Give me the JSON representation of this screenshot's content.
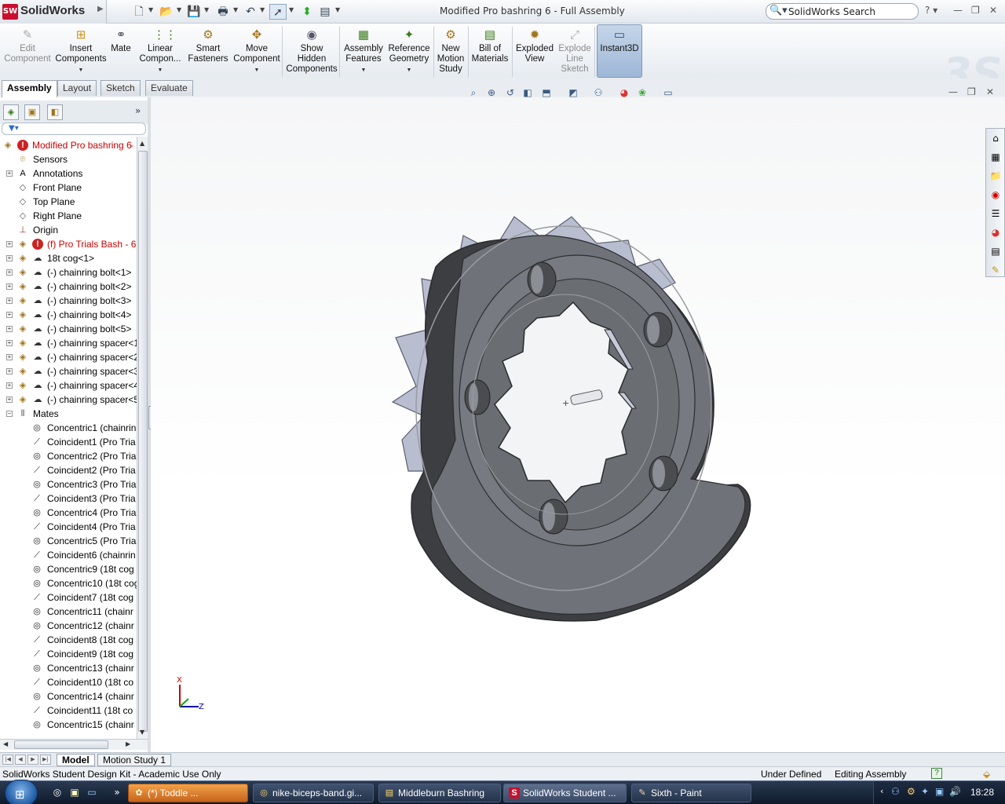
{
  "app": {
    "brand": "SolidWorks",
    "logo_letters": "SW",
    "title": "Modified Pro bashring 6 -  Full Assembly"
  },
  "search": {
    "placeholder": "SolidWorks Search"
  },
  "ribbon": {
    "buttons": [
      {
        "label": "Edit\nComponent",
        "icon": "edit-component-icon",
        "enabled": false
      },
      {
        "label": "Insert\nComponents",
        "icon": "insert-components-icon",
        "enabled": true
      },
      {
        "label": "Mate",
        "icon": "mate-icon",
        "enabled": true
      },
      {
        "label": "Linear\nCompon...",
        "icon": "linear-pattern-icon",
        "enabled": true
      },
      {
        "label": "Smart\nFasteners",
        "icon": "smart-fasteners-icon",
        "enabled": true
      },
      {
        "label": "Move\nComponent",
        "icon": "move-component-icon",
        "enabled": true
      },
      {
        "label": "Show\nHidden\nComponents",
        "icon": "show-hidden-icon",
        "enabled": true
      },
      {
        "label": "Assembly\nFeatures",
        "icon": "assembly-features-icon",
        "enabled": true
      },
      {
        "label": "Reference\nGeometry",
        "icon": "reference-geometry-icon",
        "enabled": true
      },
      {
        "label": "New\nMotion\nStudy",
        "icon": "motion-study-icon",
        "enabled": true
      },
      {
        "label": "Bill of\nMaterials",
        "icon": "bom-icon",
        "enabled": true
      },
      {
        "label": "Exploded\nView",
        "icon": "exploded-view-icon",
        "enabled": true
      },
      {
        "label": "Explode\nLine\nSketch",
        "icon": "explode-line-icon",
        "enabled": false
      },
      {
        "label": "Instant3D",
        "icon": "instant3d-icon",
        "enabled": true
      }
    ]
  },
  "command_tabs": [
    "Assembly",
    "Layout",
    "Sketch",
    "Evaluate"
  ],
  "tree": {
    "root": "Modified Pro bashring 6",
    "items": [
      {
        "label": "Sensors",
        "icon": "sensor-icon",
        "expand": false,
        "level": 1
      },
      {
        "label": "Annotations",
        "icon": "annotations-icon",
        "expand": true,
        "level": 1
      },
      {
        "label": "Front Plane",
        "icon": "plane-icon",
        "expand": false,
        "level": 1
      },
      {
        "label": "Top Plane",
        "icon": "plane-icon",
        "expand": false,
        "level": 1
      },
      {
        "label": "Right Plane",
        "icon": "plane-icon",
        "expand": false,
        "level": 1
      },
      {
        "label": "Origin",
        "icon": "origin-icon",
        "expand": false,
        "level": 1
      },
      {
        "label": "(f) Pro Trials Bash - 6<",
        "icon": "part-icon",
        "expand": true,
        "level": 1,
        "error": true
      },
      {
        "label": "18t cog<1>",
        "icon": "part-icon",
        "expand": true,
        "level": 1
      },
      {
        "label": "(-) chainring bolt<1>",
        "icon": "part-icon",
        "expand": true,
        "level": 1
      },
      {
        "label": "(-) chainring bolt<2>",
        "icon": "part-icon",
        "expand": true,
        "level": 1
      },
      {
        "label": "(-) chainring bolt<3>",
        "icon": "part-icon",
        "expand": true,
        "level": 1
      },
      {
        "label": "(-) chainring bolt<4>",
        "icon": "part-icon",
        "expand": true,
        "level": 1
      },
      {
        "label": "(-) chainring bolt<5>",
        "icon": "part-icon",
        "expand": true,
        "level": 1
      },
      {
        "label": "(-) chainring spacer<1",
        "icon": "part-icon",
        "expand": true,
        "level": 1
      },
      {
        "label": "(-) chainring spacer<2",
        "icon": "part-icon",
        "expand": true,
        "level": 1
      },
      {
        "label": "(-) chainring spacer<3",
        "icon": "part-icon",
        "expand": true,
        "level": 1
      },
      {
        "label": "(-) chainring spacer<4",
        "icon": "part-icon",
        "expand": true,
        "level": 1
      },
      {
        "label": "(-) chainring spacer<5",
        "icon": "part-icon",
        "expand": true,
        "level": 1
      },
      {
        "label": "Mates",
        "icon": "mates-icon",
        "expand": true,
        "level": 0,
        "open": true
      },
      {
        "label": "Concentric1 (chainrin",
        "icon": "concentric-icon",
        "level": 2
      },
      {
        "label": "Coincident1 (Pro Tria",
        "icon": "coincident-icon",
        "level": 2
      },
      {
        "label": "Concentric2 (Pro Tria",
        "icon": "concentric-icon",
        "level": 2
      },
      {
        "label": "Coincident2 (Pro Tria",
        "icon": "coincident-icon",
        "level": 2
      },
      {
        "label": "Concentric3 (Pro Tria",
        "icon": "concentric-icon",
        "level": 2
      },
      {
        "label": "Coincident3 (Pro Tria",
        "icon": "coincident-icon",
        "level": 2
      },
      {
        "label": "Concentric4 (Pro Tria",
        "icon": "concentric-icon",
        "level": 2
      },
      {
        "label": "Coincident4 (Pro Tria",
        "icon": "coincident-icon",
        "level": 2
      },
      {
        "label": "Concentric5 (Pro Tria",
        "icon": "concentric-icon",
        "level": 2
      },
      {
        "label": "Coincident6 (chainrin",
        "icon": "coincident-icon",
        "level": 2
      },
      {
        "label": "Concentric9 (18t cog",
        "icon": "concentric-icon",
        "level": 2
      },
      {
        "label": "Concentric10 (18t cog",
        "icon": "concentric-icon",
        "level": 2
      },
      {
        "label": "Coincident7 (18t cog",
        "icon": "coincident-icon",
        "level": 2
      },
      {
        "label": "Concentric11 (chainr",
        "icon": "concentric-icon",
        "level": 2
      },
      {
        "label": "Concentric12 (chainr",
        "icon": "concentric-icon",
        "level": 2
      },
      {
        "label": "Coincident8 (18t cog",
        "icon": "coincident-icon",
        "level": 2
      },
      {
        "label": "Coincident9 (18t cog",
        "icon": "coincident-icon",
        "level": 2
      },
      {
        "label": "Concentric13 (chainr",
        "icon": "concentric-icon",
        "level": 2
      },
      {
        "label": "Coincident10 (18t co",
        "icon": "coincident-icon",
        "level": 2
      },
      {
        "label": "Concentric14 (chainr",
        "icon": "concentric-icon",
        "level": 2
      },
      {
        "label": "Coincident11 (18t co",
        "icon": "coincident-icon",
        "level": 2
      },
      {
        "label": "Concentric15 (chainr",
        "icon": "concentric-icon",
        "level": 2
      }
    ]
  },
  "triad": {
    "x": "X",
    "z": "Z"
  },
  "model_tabs": [
    "Model",
    "Motion Study 1"
  ],
  "status": {
    "left": "SolidWorks Student Design Kit - Academic Use Only",
    "state": "Under Defined",
    "mode": "Editing Assembly",
    "help": "?"
  },
  "taskbar": {
    "items": [
      {
        "label": "(*)      Toddle        ...",
        "icon": "firefox-icon",
        "style": "orange"
      },
      {
        "label": "nike-biceps-band.gi...",
        "icon": "chrome-icon",
        "style": "normal"
      },
      {
        "label": "Middleburn Bashring",
        "icon": "document-icon",
        "style": "normal"
      },
      {
        "label": "SolidWorks Student ...",
        "icon": "solidworks-icon",
        "style": "active"
      },
      {
        "label": "Sixth - Paint",
        "icon": "paint-icon",
        "style": "normal"
      }
    ],
    "clock": "18:28"
  },
  "colors": {
    "part_fill": "#6f7278",
    "part_dark": "#3c3e42",
    "part_light": "#9fa3aa",
    "cog_fill": "#b9bdd0",
    "accent_red": "#c8102e"
  }
}
